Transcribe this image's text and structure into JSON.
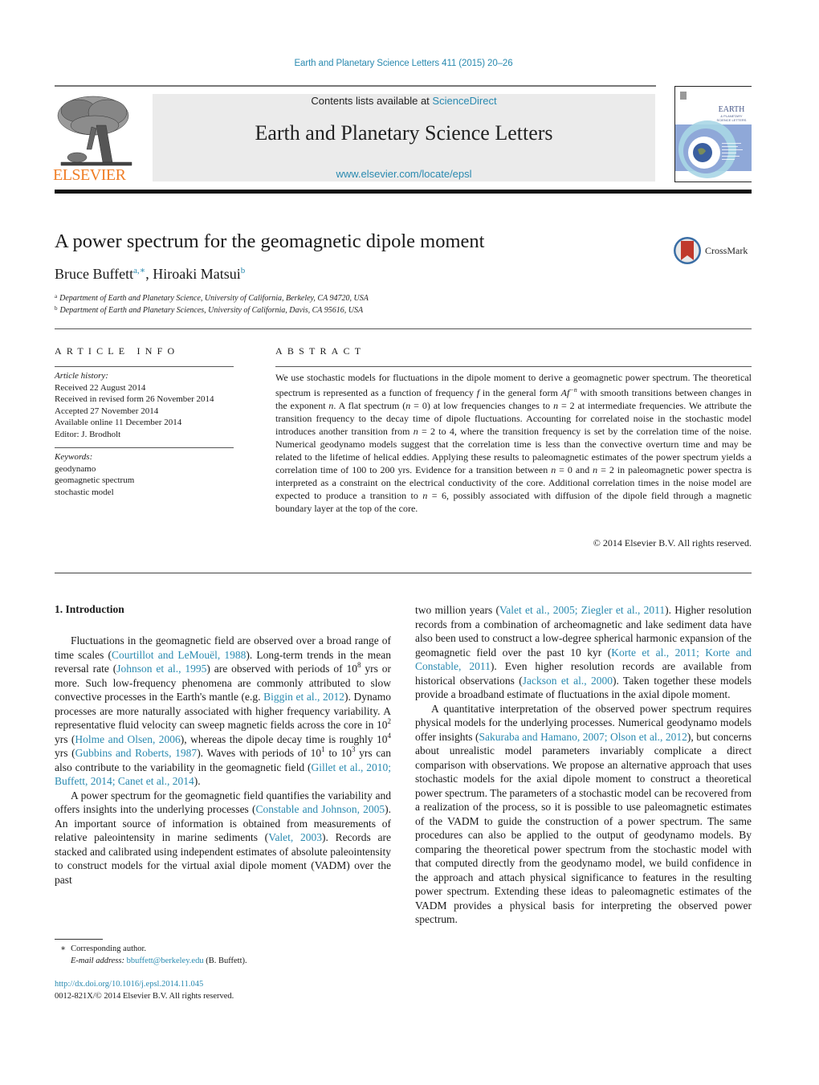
{
  "header": {
    "journal_reference": "Earth and Planetary Science Letters 411 (2015) 20–26",
    "contents_prefix": "Contents lists available at ",
    "contents_link": "ScienceDirect",
    "journal_title": "Earth and Planetary Science Letters",
    "journal_url": "www.elsevier.com/locate/epsl",
    "publisher_logo_text": "ELSEVIER",
    "cover_title_line1": "EARTH",
    "cover_title_line2": "& PLANETARY",
    "cover_title_line3": "SCIENCE LETTERS",
    "colors": {
      "link": "#2a8ab0",
      "elsevier_orange": "#f07e26",
      "masthead_bg": "#ebebeb",
      "cover_blue": "#8fa8d8",
      "crossmark_red": "#c0392b"
    }
  },
  "article": {
    "title": "A power spectrum for the geomagnetic dipole moment",
    "crossmark_label": "CrossMark",
    "authors": [
      {
        "name": "Bruce Buffett",
        "marks": "a,∗"
      },
      {
        "name": "Hiroaki Matsui",
        "marks": "b"
      }
    ],
    "author_separator": ", ",
    "affiliations": [
      {
        "mark": "a",
        "text": "Department of Earth and Planetary Science, University of California, Berkeley, CA 94720, USA"
      },
      {
        "mark": "b",
        "text": "Department of Earth and Planetary Sciences, University of California, Davis, CA 95616, USA"
      }
    ]
  },
  "article_info": {
    "heading": "ARTICLE INFO",
    "history_label": "Article history:",
    "history": [
      "Received 22 August 2014",
      "Received in revised form 26 November 2014",
      "Accepted 27 November 2014",
      "Available online 11 December 2014",
      "Editor: J. Brodholt"
    ],
    "keywords_label": "Keywords:",
    "keywords": [
      "geodynamo",
      "geomagnetic spectrum",
      "stochastic model"
    ]
  },
  "abstract": {
    "heading": "ABSTRACT",
    "text": [
      "We use stochastic models for fluctuations in the dipole moment to derive a geomagnetic power spectrum. The theoretical spectrum is represented as a function of frequency ",
      {
        "math": "f"
      },
      " in the general form ",
      {
        "math": "Af",
        "sup": "−n"
      },
      " with smooth transitions between changes in the exponent ",
      {
        "math": "n"
      },
      ". A flat spectrum (",
      {
        "math": "n"
      },
      " = 0) at low frequencies changes to ",
      {
        "math": "n"
      },
      " = 2 at intermediate frequencies. We attribute the transition frequency to the decay time of dipole fluctuations. Accounting for correlated noise in the stochastic model introduces another transition from ",
      {
        "math": "n"
      },
      " = 2 to 4, where the transition frequency is set by the correlation time of the noise. Numerical geodynamo models suggest that the correlation time is less than the convective overturn time and may be related to the lifetime of helical eddies. Applying these results to paleomagnetic estimates of the power spectrum yields a correlation time of 100 to 200 yrs. Evidence for a transition between ",
      {
        "math": "n"
      },
      " = 0 and ",
      {
        "math": "n"
      },
      " = 2 in paleomagnetic power spectra is interpreted as a constraint on the electrical conductivity of the core. Additional correlation times in the noise model are expected to produce a transition to ",
      {
        "math": "n"
      },
      " = 6, possibly associated with diffusion of the dipole field through a magnetic boundary layer at the top of the core."
    ],
    "copyright": "© 2014 Elsevier B.V. All rights reserved."
  },
  "body": {
    "section_heading": "1.  Introduction",
    "left_paragraphs": [
      [
        "Fluctuations in the geomagnetic field are observed over a broad range of time scales (",
        {
          "link": "Courtillot and LeMouël, 1988"
        },
        "). Long-term trends in the mean reversal rate (",
        {
          "link": "Johnson et al., 1995"
        },
        ") are observed with periods of 10",
        {
          "sup": "8"
        },
        " yrs or more. Such low-frequency phenomena are commonly attributed to slow convective processes in the Earth's mantle (e.g. ",
        {
          "link": "Biggin et al., 2012"
        },
        "). Dynamo processes are more naturally associated with higher frequency variability. A representative fluid velocity can sweep magnetic fields across the core in 10",
        {
          "sup": "2"
        },
        " yrs (",
        {
          "link": "Holme and Olsen, 2006"
        },
        "), whereas the dipole decay time is roughly 10",
        {
          "sup": "4"
        },
        " yrs (",
        {
          "link": "Gubbins and Roberts, 1987"
        },
        "). Waves with periods of 10",
        {
          "sup": "1"
        },
        " to 10",
        {
          "sup": "3"
        },
        " yrs can also contribute to the variability in the geomagnetic field (",
        {
          "link": "Gillet et al., 2010; Buffett, 2014; Canet et al., 2014"
        },
        ")."
      ],
      [
        "A power spectrum for the geomagnetic field quantifies the variability and offers insights into the underlying processes (",
        {
          "link": "Constable and Johnson, 2005"
        },
        "). An important source of information is obtained from measurements of relative paleointensity in marine sediments (",
        {
          "link": "Valet, 2003"
        },
        "). Records are stacked and calibrated using independent estimates of absolute paleointensity to construct models for the virtual axial dipole moment (VADM) over the past"
      ]
    ],
    "right_paragraphs": [
      [
        "two million years (",
        {
          "link": "Valet et al., 2005; Ziegler et al., 2011"
        },
        "). Higher resolution records from a combination of archeomagnetic and lake sediment data have also been used to construct a low-degree spherical harmonic expansion of the geomagnetic field over the past 10 kyr (",
        {
          "link": "Korte et al., 2011; Korte and Constable, 2011"
        },
        "). Even higher resolution records are available from historical observations (",
        {
          "link": "Jackson et al., 2000"
        },
        "). Taken together these models provide a broadband estimate of fluctuations in the axial dipole moment."
      ],
      [
        "A quantitative interpretation of the observed power spectrum requires physical models for the underlying processes. Numerical geodynamo models offer insights (",
        {
          "link": "Sakuraba and Hamano, 2007; Olson et al., 2012"
        },
        "), but concerns about unrealistic model parameters invariably complicate a direct comparison with observations. We propose an alternative approach that uses stochastic models for the axial dipole moment to construct a theoretical power spectrum. The parameters of a stochastic model can be recovered from a realization of the process, so it is possible to use paleomagnetic estimates of the VADM to guide the construction of a power spectrum. The same procedures can also be applied to the output of geodynamo models. By comparing the theoretical power spectrum from the stochastic model with that computed directly from the geodynamo model, we build confidence in the approach and attach physical significance to features in the resulting power spectrum. Extending these ideas to paleomagnetic estimates of the VADM provides a physical basis for interpreting the observed power spectrum."
      ]
    ]
  },
  "footnote": {
    "mark": "∗",
    "corresponding": "Corresponding author.",
    "email_label": "E-mail address:",
    "email": "bbuffett@berkeley.edu",
    "email_suffix": " (B. Buffett)."
  },
  "footer": {
    "doi": "http://dx.doi.org/10.1016/j.epsl.2014.11.045",
    "issn_copyright": "0012-821X/© 2014 Elsevier B.V. All rights reserved."
  }
}
